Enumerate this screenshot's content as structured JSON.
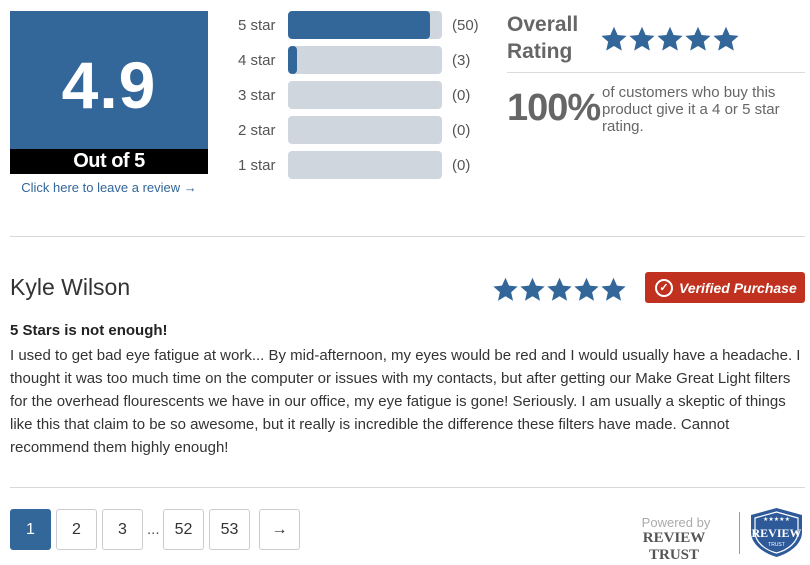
{
  "summary": {
    "score": "4.9",
    "out_of": "Out of 5",
    "leave_review": "Click here to leave a review →"
  },
  "distribution": [
    {
      "label": "5 star",
      "count": "(50)",
      "fraction": 0.92
    },
    {
      "label": "4 star",
      "count": "(3)",
      "fraction": 0.06
    },
    {
      "label": "3 star",
      "count": "(0)",
      "fraction": 0
    },
    {
      "label": "2 star",
      "count": "(0)",
      "fraction": 0
    },
    {
      "label": "1 star",
      "count": "(0)",
      "fraction": 0
    }
  ],
  "overall": {
    "title_line1": "Overall",
    "title_line2": "Rating",
    "stars": 5,
    "percent": "100%",
    "percent_text": "of customers who buy this product give it a 4 or 5 star rating."
  },
  "review": {
    "author": "Kyle Wilson",
    "stars": 5,
    "verified_label": "Verified Purchase",
    "title": "5 Stars is not enough!",
    "body": "I used to get bad eye fatigue at work... By mid-afternoon, my eyes would be red and I would usually have a headache. I thought it was too much time on the computer or issues with my contacts, but after getting our Make Great Light filters for the overhead flourescents we have in our office, my eye fatigue is gone! Seriously. I am usually a skeptic of things like this that claim to be so awesome, but it really is incredible the difference these filters have made. Cannot recommend them highly enough!"
  },
  "pagination": {
    "pages": [
      "1",
      "2",
      "3",
      "52",
      "53"
    ],
    "active": "1",
    "ellipsis": "...",
    "next": "→"
  },
  "footer": {
    "powered_by": "Powered by",
    "brand": "REVIEW TRUST",
    "badge_text": "REVIEW",
    "badge_sub": "TRUST"
  },
  "colors": {
    "accent": "#336699",
    "verified": "#c0321f"
  },
  "icons": {
    "star": "star-icon",
    "check": "check-circle-icon",
    "badge": "review-trust-shield-icon"
  }
}
